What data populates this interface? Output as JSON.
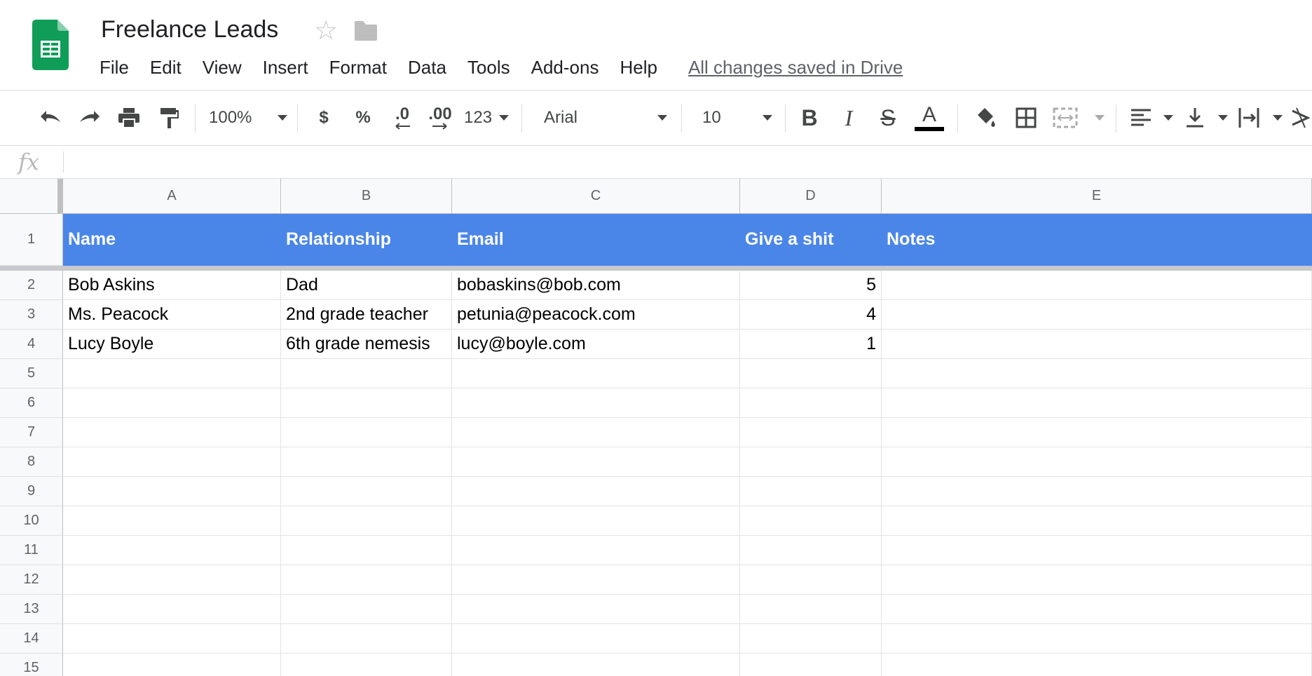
{
  "doc": {
    "title": "Freelance Leads",
    "star_icon": "star-icon",
    "folder_icon": "folder-icon",
    "menu": [
      "File",
      "Edit",
      "View",
      "Insert",
      "Format",
      "Data",
      "Tools",
      "Add-ons",
      "Help"
    ],
    "saved_status": "All changes saved in Drive"
  },
  "toolbar": {
    "zoom": "100%",
    "currency": "$",
    "percent": "%",
    "decrease_decimals": ".0",
    "increase_decimals": ".00",
    "more_formats": "123",
    "font": "Arial",
    "font_size": "10",
    "text_color_underline": "#000000"
  },
  "formula_bar": {
    "fx_label": "fx",
    "content": ""
  },
  "sheet": {
    "columns": [
      "A",
      "B",
      "C",
      "D",
      "E"
    ],
    "row_numbers": [
      "1",
      "2",
      "3",
      "4",
      "5",
      "6",
      "7",
      "8",
      "9",
      "10",
      "11",
      "12",
      "13",
      "14",
      "15"
    ],
    "header_fill": "#4a86e8",
    "rows": [
      [
        "Name",
        "Relationship",
        "Email",
        "Give a shit",
        "Notes"
      ],
      [
        "Bob Askins",
        "Dad",
        "bobaskins@bob.com",
        "5",
        ""
      ],
      [
        "Ms. Peacock",
        "2nd grade teacher",
        "petunia@peacock.com",
        "4",
        ""
      ],
      [
        "Lucy Boyle",
        "6th grade nemesis",
        "lucy@boyle.com",
        "1",
        ""
      ]
    ]
  }
}
